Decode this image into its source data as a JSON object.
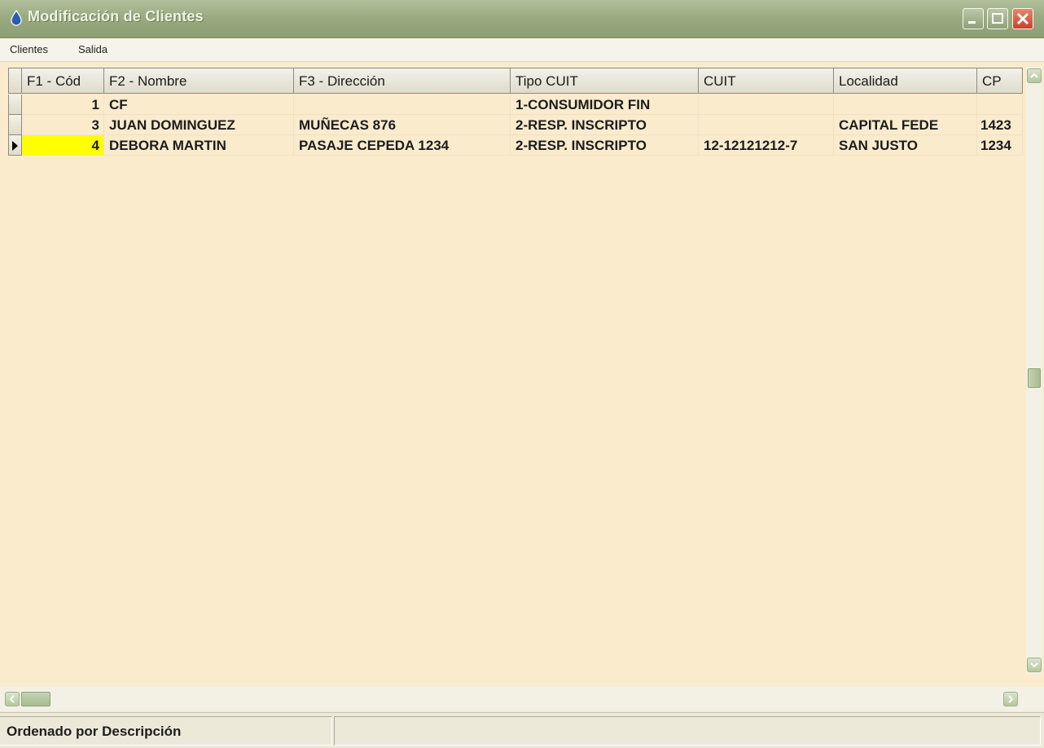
{
  "window": {
    "title": "Modificación de Clientes"
  },
  "menu": {
    "items": [
      {
        "label": "Clientes"
      },
      {
        "label": "Salida"
      }
    ]
  },
  "grid": {
    "columns": [
      {
        "label": "F1 - Cód"
      },
      {
        "label": "F2 - Nombre"
      },
      {
        "label": "F3 - Dirección"
      },
      {
        "label": "Tipo  CUIT"
      },
      {
        "label": "CUIT"
      },
      {
        "label": "Localidad"
      },
      {
        "label": "CP"
      }
    ],
    "rows": [
      {
        "cod": "1",
        "nombre": "CF",
        "direccion": "",
        "tipo_cuit": "1-CONSUMIDOR FIN",
        "cuit": "",
        "localidad": "",
        "cp": ""
      },
      {
        "cod": "3",
        "nombre": "JUAN DOMINGUEZ",
        "direccion": "MUÑECAS 876",
        "tipo_cuit": "2-RESP. INSCRIPTO",
        "cuit": "",
        "localidad": "CAPITAL FEDE",
        "cp": "1423"
      },
      {
        "cod": "4",
        "nombre": "DEBORA MARTIN",
        "direccion": "PASAJE CEPEDA 1234",
        "tipo_cuit": "2-RESP. INSCRIPTO",
        "cuit": "12-12121212-7",
        "localidad": "SAN JUSTO",
        "cp": "1234"
      }
    ],
    "selected_row": 3,
    "colors": {
      "background": "#faebcd",
      "selected_cell": "#ffff00"
    }
  },
  "status": {
    "text": "Ordenado por Descripción"
  },
  "icons": {
    "app": "app-drop-icon",
    "minimize": "minimize-icon",
    "maximize": "maximize-icon",
    "close": "close-icon",
    "row_pointer": "row-pointer-icon"
  }
}
